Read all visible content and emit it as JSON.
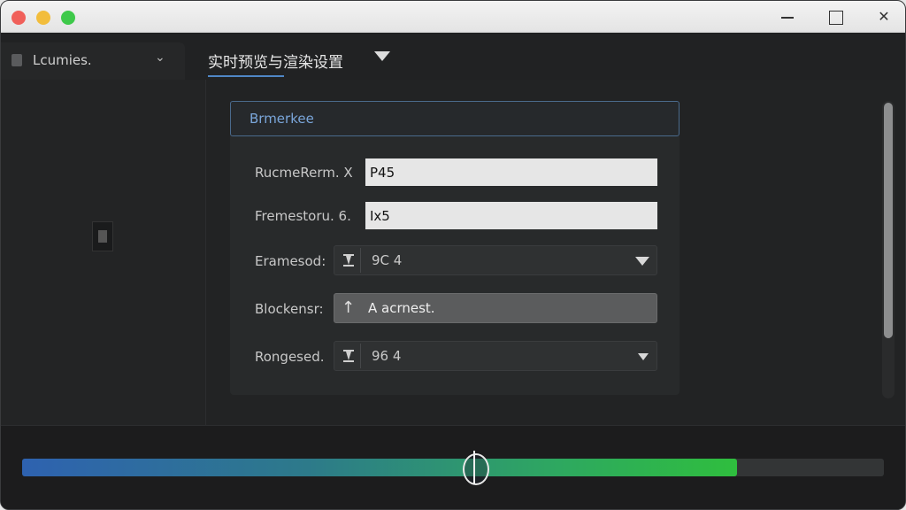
{
  "window": {
    "controls": {
      "minimize": "minimize",
      "maximize": "maximize",
      "close": "✕"
    }
  },
  "tabs": {
    "side_tab_label": "Lcumies.",
    "main_tab_label": "实时预览与渲染设置"
  },
  "panel": {
    "header": "Brmerkee",
    "fields": [
      {
        "label": "RucmeRerm. X",
        "value": "P45"
      },
      {
        "label": "Fremestoru. 6.",
        "value": "Ix5"
      }
    ],
    "selects": [
      {
        "label": "Eramesod:",
        "value": "9C 4"
      },
      {
        "label": "Rongesed.",
        "value": "96 4"
      }
    ],
    "upload": {
      "label": "Blockensr:",
      "value": "A acrnest.",
      "icon": "arrow-up-icon"
    }
  },
  "timeline": {
    "progress": 0.83,
    "handle_position": 0.525
  },
  "colors": {
    "accent": "#4f86c6",
    "header_text": "#7aa6da",
    "progress_start": "#2e62b0",
    "progress_end": "#2fbe3e"
  }
}
